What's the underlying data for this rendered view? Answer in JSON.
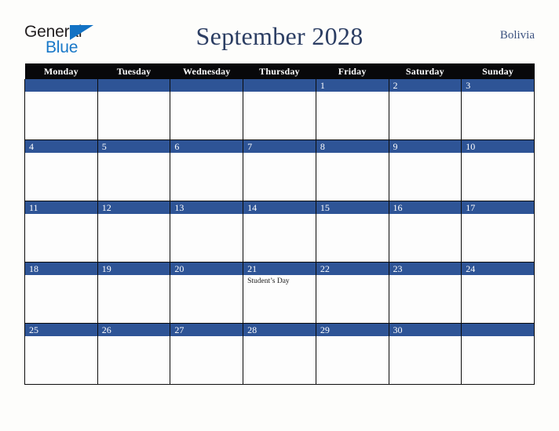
{
  "brand": {
    "name_part1": "General",
    "name_part2": "Blue",
    "triangle_icon": "blue-triangle-icon",
    "colors": {
      "dark": "#231f20",
      "blue": "#1878c8",
      "triangle": "#1272c4"
    }
  },
  "header": {
    "title": "September 2028",
    "country": "Bolivia",
    "title_color": "#2c3e63",
    "country_color": "#3c5280"
  },
  "calendar": {
    "month": "September",
    "year": "2028",
    "header_bg": "#08080a",
    "daybar_bg": "#2e5496",
    "weekday_headers": [
      "Monday",
      "Tuesday",
      "Wednesday",
      "Thursday",
      "Friday",
      "Saturday",
      "Sunday"
    ],
    "weeks": [
      [
        {
          "day": "",
          "events": []
        },
        {
          "day": "",
          "events": []
        },
        {
          "day": "",
          "events": []
        },
        {
          "day": "",
          "events": []
        },
        {
          "day": "1",
          "events": []
        },
        {
          "day": "2",
          "events": []
        },
        {
          "day": "3",
          "events": []
        }
      ],
      [
        {
          "day": "4",
          "events": []
        },
        {
          "day": "5",
          "events": []
        },
        {
          "day": "6",
          "events": []
        },
        {
          "day": "7",
          "events": []
        },
        {
          "day": "8",
          "events": []
        },
        {
          "day": "9",
          "events": []
        },
        {
          "day": "10",
          "events": []
        }
      ],
      [
        {
          "day": "11",
          "events": []
        },
        {
          "day": "12",
          "events": []
        },
        {
          "day": "13",
          "events": []
        },
        {
          "day": "14",
          "events": []
        },
        {
          "day": "15",
          "events": []
        },
        {
          "day": "16",
          "events": []
        },
        {
          "day": "17",
          "events": []
        }
      ],
      [
        {
          "day": "18",
          "events": []
        },
        {
          "day": "19",
          "events": []
        },
        {
          "day": "20",
          "events": []
        },
        {
          "day": "21",
          "events": [
            "Student’s Day"
          ]
        },
        {
          "day": "22",
          "events": []
        },
        {
          "day": "23",
          "events": []
        },
        {
          "day": "24",
          "events": []
        }
      ],
      [
        {
          "day": "25",
          "events": []
        },
        {
          "day": "26",
          "events": []
        },
        {
          "day": "27",
          "events": []
        },
        {
          "day": "28",
          "events": []
        },
        {
          "day": "29",
          "events": []
        },
        {
          "day": "30",
          "events": []
        },
        {
          "day": "",
          "events": []
        }
      ]
    ]
  }
}
